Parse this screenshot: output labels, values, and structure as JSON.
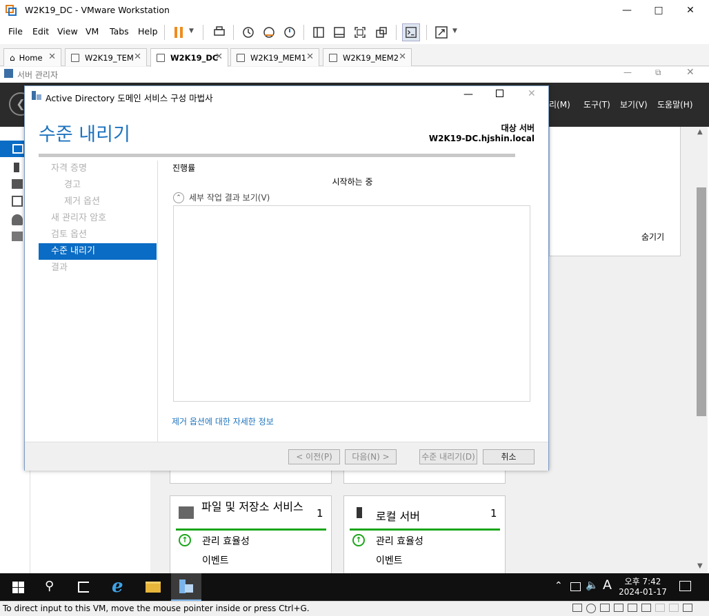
{
  "vmware": {
    "window_title": "W2K19_DC - VMware Workstation",
    "menu": [
      "File",
      "Edit",
      "View",
      "VM",
      "Tabs",
      "Help"
    ],
    "tabs": [
      {
        "label": "Home",
        "active": false
      },
      {
        "label": "W2K19_TEM",
        "active": false
      },
      {
        "label": "W2K19_DC",
        "active": true
      },
      {
        "label": "W2K19_MEM1",
        "active": false
      },
      {
        "label": "W2K19_MEM2",
        "active": false
      }
    ],
    "status_text": "To direct input to this VM, move the mouse pointer inside or press Ctrl+G."
  },
  "server_manager": {
    "title": "서버 관리자",
    "menus": [
      "리(M)",
      "도구(T)",
      "보기(V)",
      "도움말(H)"
    ],
    "hide_label": "숨기기",
    "tiles": [
      {
        "title": "파일 및 저장소 서비스",
        "count": "1",
        "row1": "관리 효율성",
        "row2": "이벤트"
      },
      {
        "title": "로컬 서버",
        "count": "1",
        "row1": "관리 효율성",
        "row2": "이벤트"
      }
    ]
  },
  "wizard": {
    "title": "Active Directory 도메인 서비스 구성 마법사",
    "heading": "수준 내리기",
    "target_label": "대상 서버",
    "target_server": "W2K19-DC.hjshin.local",
    "steps": [
      {
        "label": "자격 증명",
        "sub": false,
        "active": false
      },
      {
        "label": "경고",
        "sub": true,
        "active": false
      },
      {
        "label": "제거 옵션",
        "sub": true,
        "active": false
      },
      {
        "label": "새 관리자 암호",
        "sub": false,
        "active": false
      },
      {
        "label": "검토 옵션",
        "sub": false,
        "active": false
      },
      {
        "label": "수준 내리기",
        "sub": false,
        "active": true
      },
      {
        "label": "결과",
        "sub": false,
        "active": false
      }
    ],
    "progress_label": "진행률",
    "progress_fraction": 1.0,
    "status": "시작하는 중",
    "details_toggle": "세부 작업 결과 보기(V)",
    "more_link": "제거 옵션에 대한 자세한 정보",
    "buttons": {
      "prev": "< 이전(P)",
      "next": "다음(N) >",
      "demote": "수준 내리기(D)",
      "cancel": "취소"
    }
  },
  "taskbar": {
    "time": "오후 7:42",
    "date": "2024-01-17",
    "ime": "A"
  },
  "colors": {
    "accent": "#0a6cc4",
    "heading": "#1e73be",
    "tile_bar": "#1aa51a",
    "pause": "#f08c1e"
  }
}
